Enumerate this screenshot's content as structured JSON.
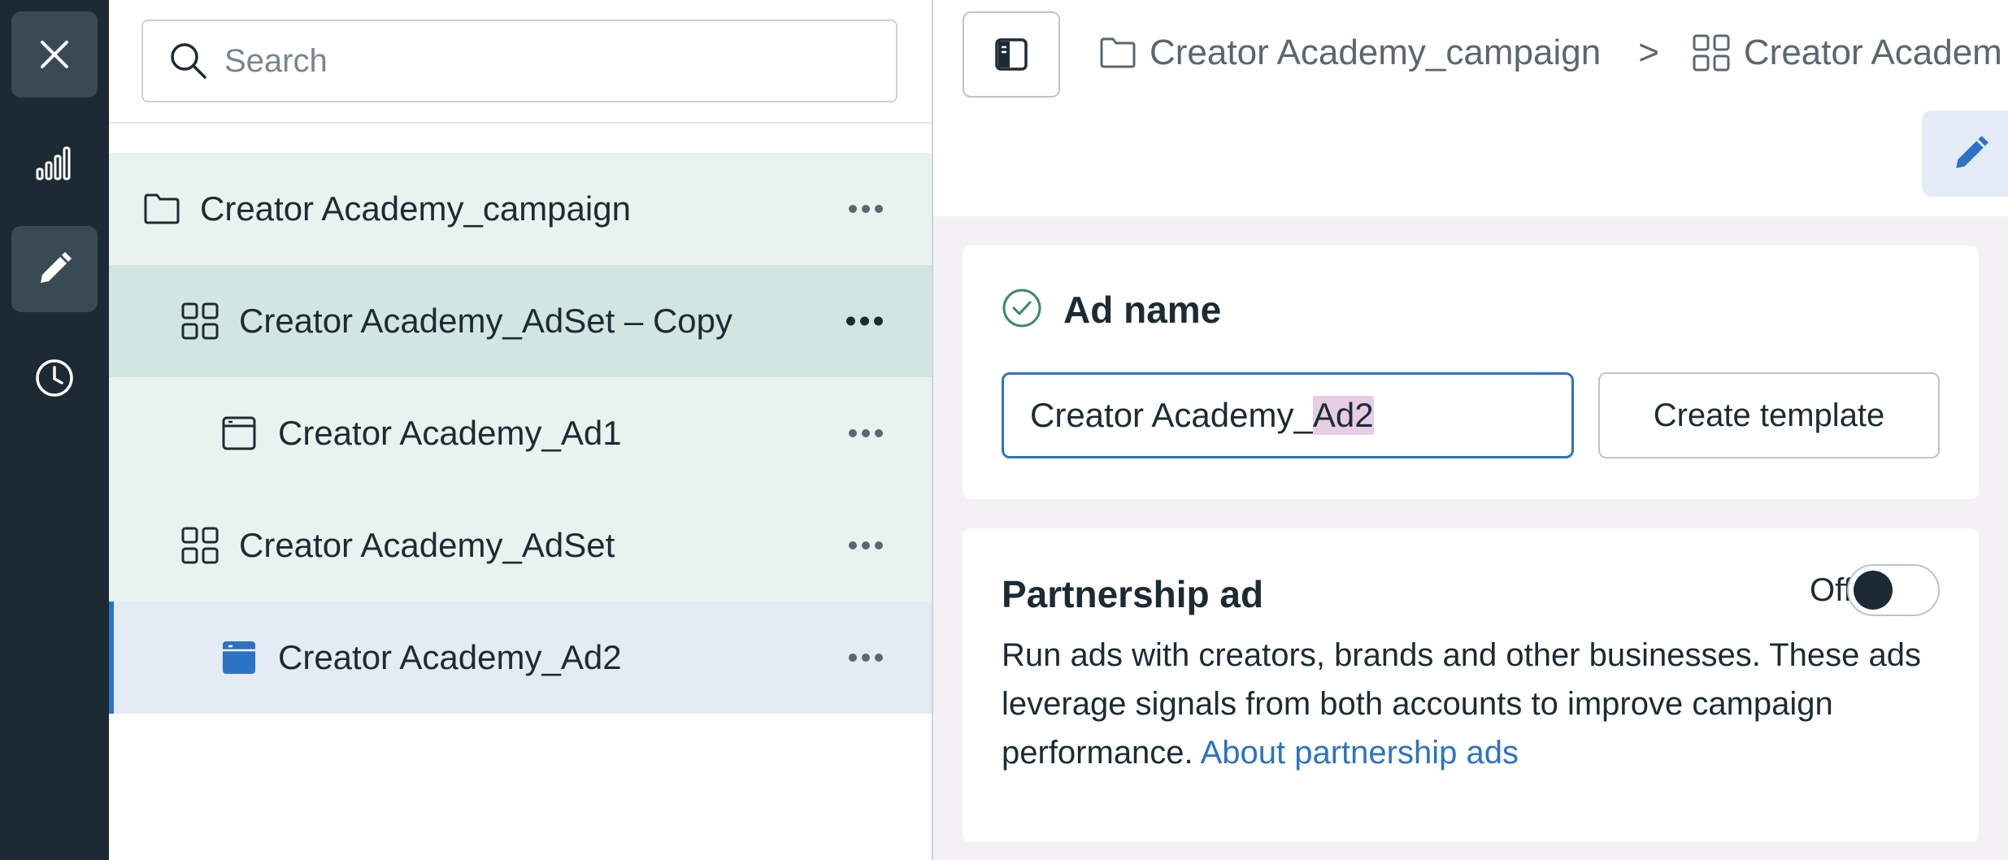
{
  "search": {
    "placeholder": "Search"
  },
  "tree": {
    "campaign": "Creator Academy_campaign",
    "adset_copy": "Creator Academy_AdSet – Copy",
    "ad1": "Creator Academy_Ad1",
    "adset": "Creator Academy_AdSet",
    "ad2": "Creator Academy_Ad2"
  },
  "breadcrumb": {
    "campaign": "Creator Academy_campaign",
    "separator": ">",
    "adset": "Creator Academ"
  },
  "ad_name": {
    "title": "Ad name",
    "value_prefix": "Creator Academy_",
    "value_selected": "Ad2",
    "create_template_label": "Create template"
  },
  "partnership": {
    "title": "Partnership ad",
    "toggle_state": "Off",
    "description": "Run ads with creators, brands and other businesses. These ads leverage signals from both accounts to improve campaign performance.",
    "link_text": "About partnership ads"
  },
  "icons": {
    "rail": [
      "close-icon",
      "chart-icon",
      "pencil-icon",
      "clock-icon"
    ],
    "tree": [
      "folder-icon",
      "adset-grid-icon",
      "ad-icon"
    ]
  },
  "colors": {
    "rail_bg": "#1c2b33",
    "accent_blue": "#2d73c5",
    "tree_green_bg": "#e8f3ef",
    "tree_green_selected": "#d2e6e1",
    "tree_blue_selected": "#e3ecf5",
    "green_bar": "#3b8a5f"
  }
}
